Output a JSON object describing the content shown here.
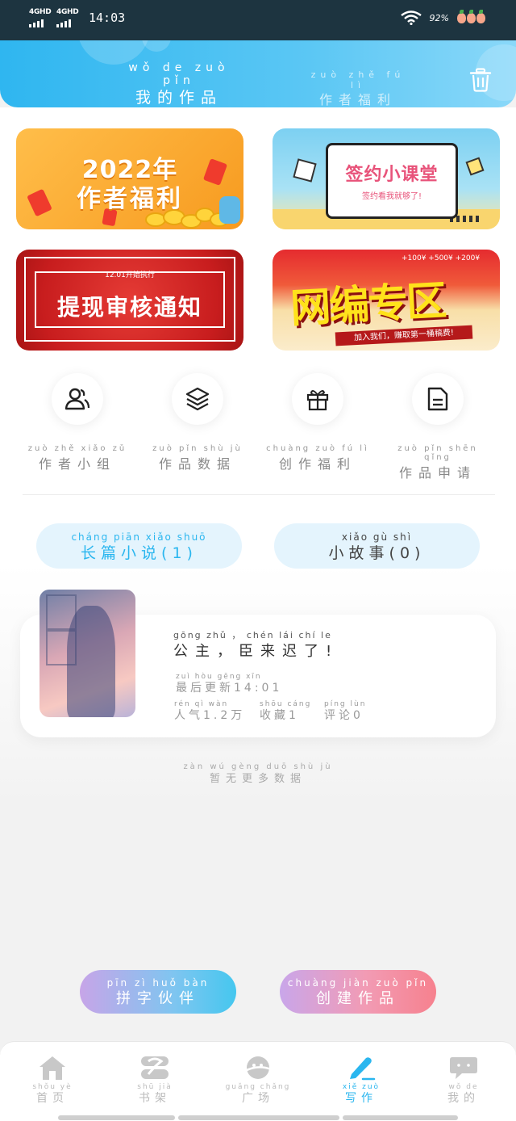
{
  "status": {
    "net1": "4GHD",
    "net2": "4GHD",
    "time": "14:03",
    "battery": "92%"
  },
  "header": {
    "tab_active_py": "wǒ de zuò pǐn",
    "tab_active_hz": "我的作品",
    "tab_inactive_py": "zuò zhě fú lì",
    "tab_inactive_hz": "作者福利"
  },
  "banners": {
    "b1_line1": "2022年",
    "b1_line2": "作者福利",
    "b2_title": "签约小课堂",
    "b2_sub": "签约看我就够了!",
    "b3_small": "12.01开始执行",
    "b3_big": "提现审核通知",
    "b4_big": "网编专区",
    "b4_strip": "加入我们，赚取第一桶稿费!",
    "b4_money": "+100¥ +500¥ +200¥"
  },
  "quick": [
    {
      "py": "zuò zhě xiǎo zǔ",
      "hz": "作者小组"
    },
    {
      "py": "zuò pǐn shù jù",
      "hz": "作品数据"
    },
    {
      "py": "chuàng zuò fú lì",
      "hz": "创作福利"
    },
    {
      "py": "zuò pǐn shēn qǐng",
      "hz": "作品申请"
    }
  ],
  "pills": {
    "novel_py": "cháng piān xiǎo shuō",
    "novel_hz": "长篇小说(1)",
    "story_py": "xiǎo gù shì",
    "story_hz": "小故事(0)"
  },
  "work": {
    "title_py": "gōng zhǔ ， chén lái chí le",
    "title_hz": "公主，臣来迟了!",
    "update_py": "zuì hòu gēng xīn",
    "update_hz": "最后更新14:01",
    "pop_py": "rén qì wàn",
    "pop_hz": "人气1.2万",
    "fav_py": "shōu cáng",
    "fav_hz": "收藏1",
    "comment_py": "píng lùn",
    "comment_hz": "评论0"
  },
  "nomore": {
    "py": "zàn wú gèng duō shù jù",
    "hz": "暂无更多数据"
  },
  "buttons": {
    "partner_py": "pīn zì huǒ bàn",
    "partner_hz": "拼字伙伴",
    "create_py": "chuàng jiàn zuò pǐn",
    "create_hz": "创建作品"
  },
  "nav": [
    {
      "py": "shǒu yè",
      "hz": "首页",
      "icon": "home-icon"
    },
    {
      "py": "shū jià",
      "hz": "书架",
      "icon": "bookshelf-icon"
    },
    {
      "py": "guǎng chǎng",
      "hz": "广场",
      "icon": "planet-icon"
    },
    {
      "py": "xiě zuò",
      "hz": "写作",
      "icon": "pen-icon"
    },
    {
      "py": "wǒ de",
      "hz": "我的",
      "icon": "chat-icon"
    }
  ],
  "colors": {
    "accent": "#2ab6ef",
    "header_start": "#2fb6f0",
    "pill_bg": "#e4f4fd"
  }
}
